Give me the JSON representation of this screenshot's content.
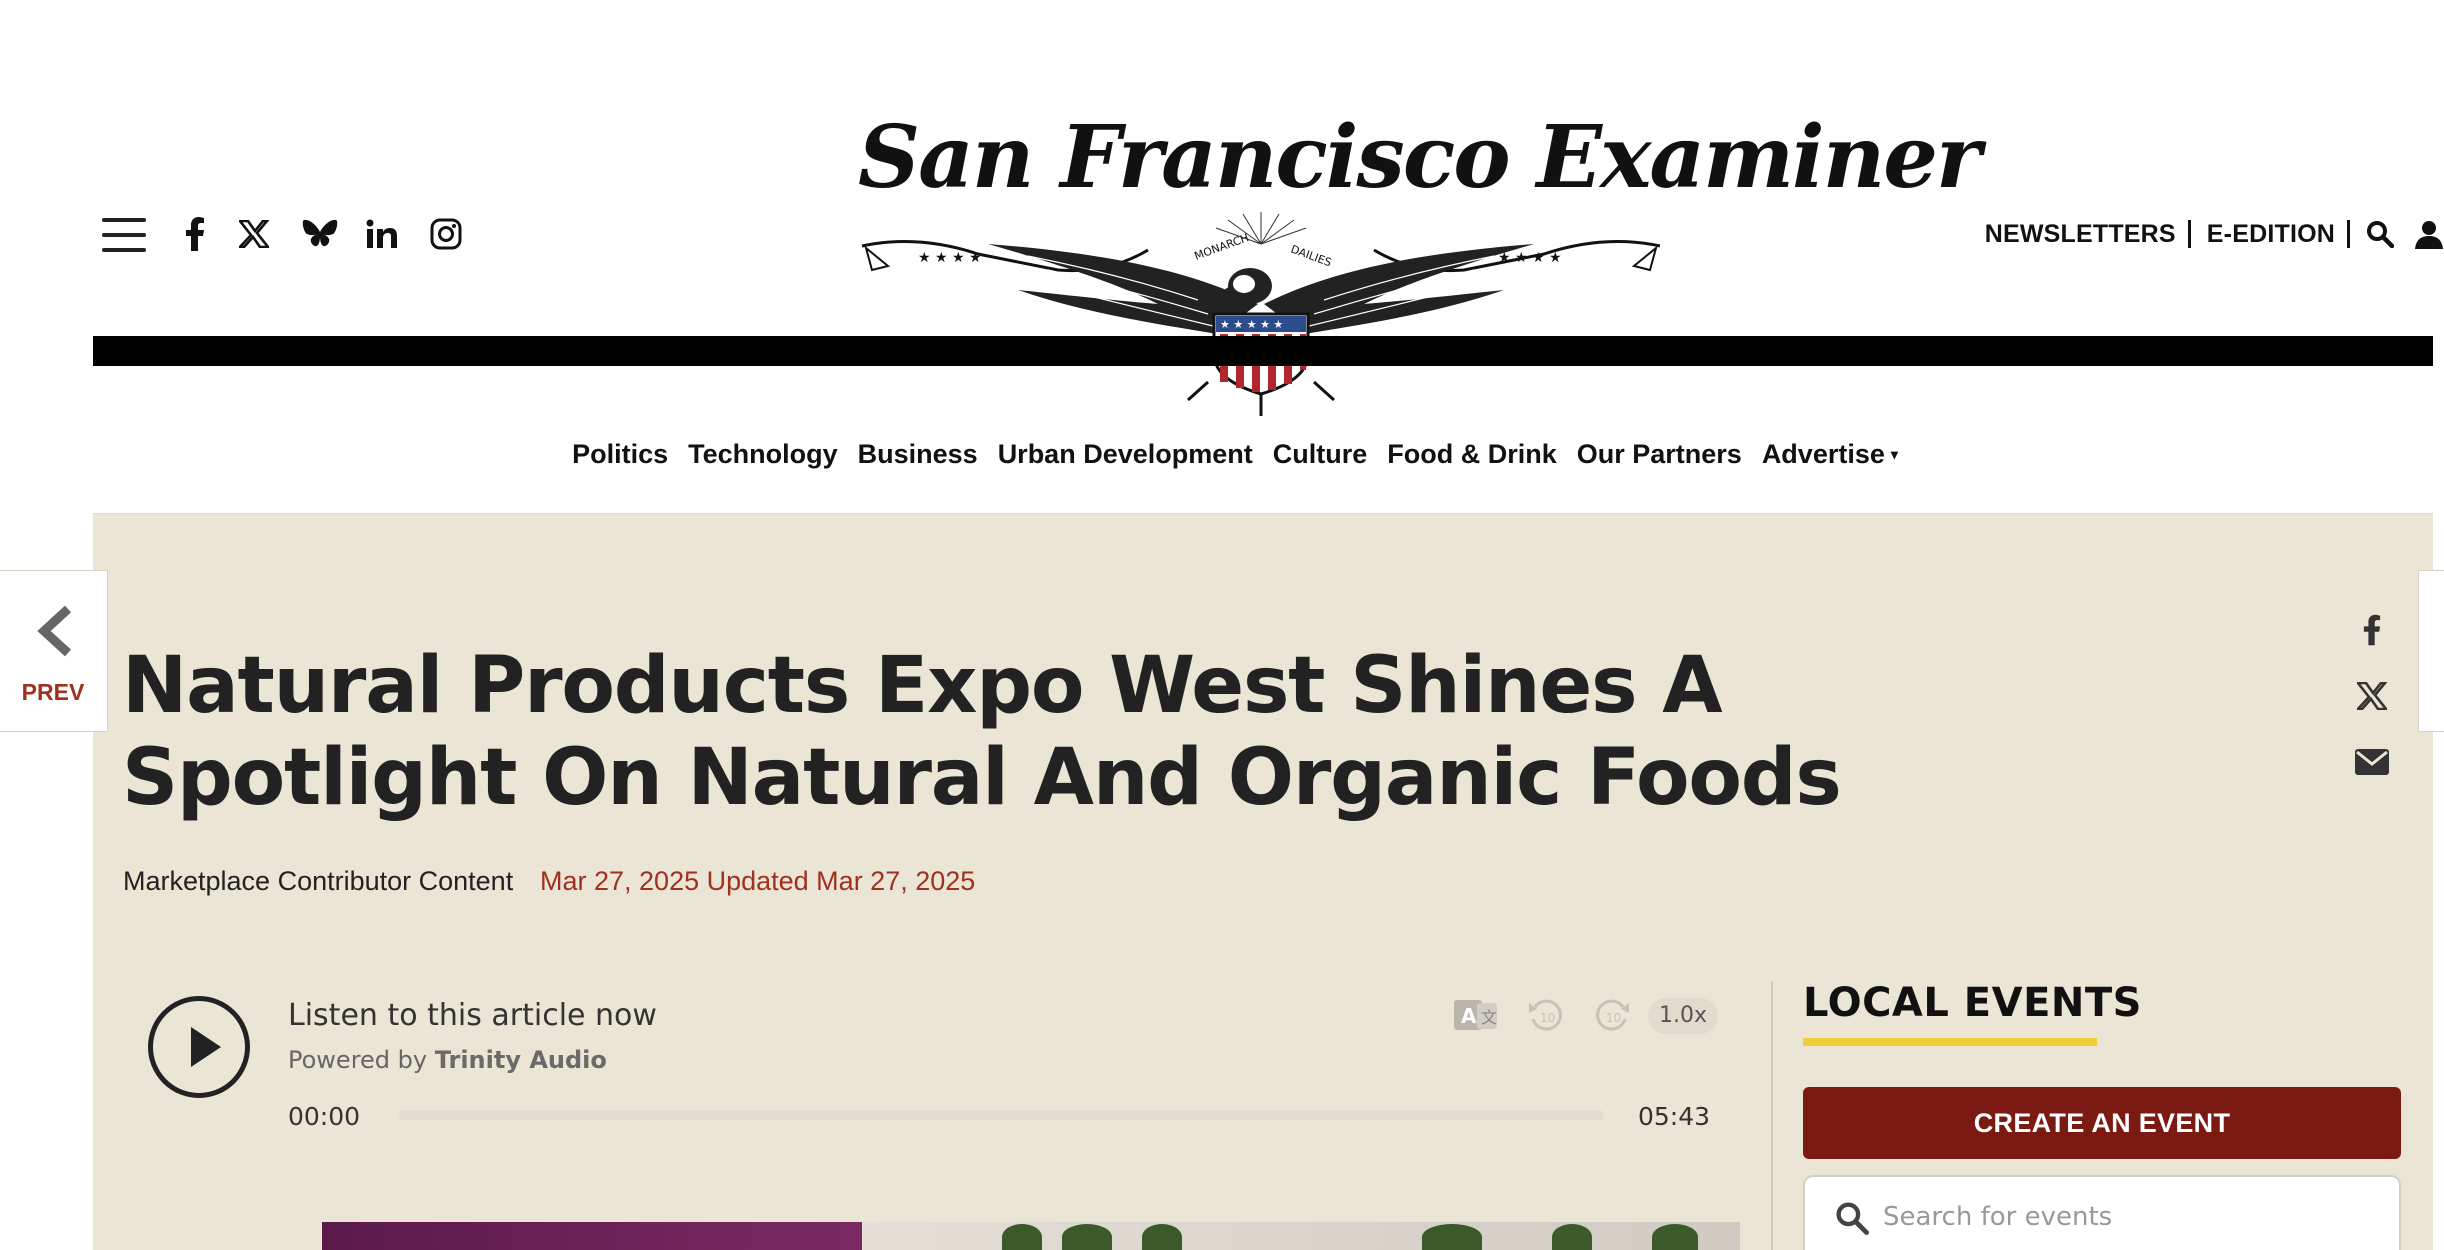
{
  "header": {
    "logo_text": "San Francisco Examiner",
    "logo_ribbon_left": "MONARCH",
    "logo_ribbon_right": "DAILIES",
    "links": [
      "NEWSLETTERS",
      "E-EDITION"
    ],
    "social_icons": [
      "facebook-icon",
      "x-icon",
      "bluesky-icon",
      "linkedin-icon",
      "instagram-icon"
    ]
  },
  "nav": {
    "items": [
      "Politics",
      "Technology",
      "Business",
      "Urban Development",
      "Culture",
      "Food & Drink",
      "Our Partners",
      "Advertise"
    ],
    "advertise_caret": "▾"
  },
  "prev": {
    "label": "PREV"
  },
  "article": {
    "headline": "Natural Products Expo West Shines A Spotlight On Natural And Organic Foods",
    "byline": "Marketplace Contributor Content",
    "dateline": "Mar 27, 2025 Updated Mar 27, 2025"
  },
  "share": [
    "facebook-icon",
    "x-icon",
    "email-icon"
  ],
  "audio": {
    "title": "Listen to this article now",
    "powered_prefix": "Powered by",
    "powered_brand": "Trinity Audio",
    "current_time": "00:00",
    "duration": "05:43",
    "progress": 0,
    "speed": "1.0x",
    "rewind_label": "10",
    "forward_label": "10"
  },
  "sidebar": {
    "events_title": "LOCAL EVENTS",
    "create_button": "CREATE AN EVENT",
    "search_placeholder": "Search for events"
  },
  "colors": {
    "accent_red": "#a0301f",
    "button_maroon": "#7b1a12",
    "underline_yellow": "#f0cf3a",
    "page_beige": "#ebe5d5"
  }
}
